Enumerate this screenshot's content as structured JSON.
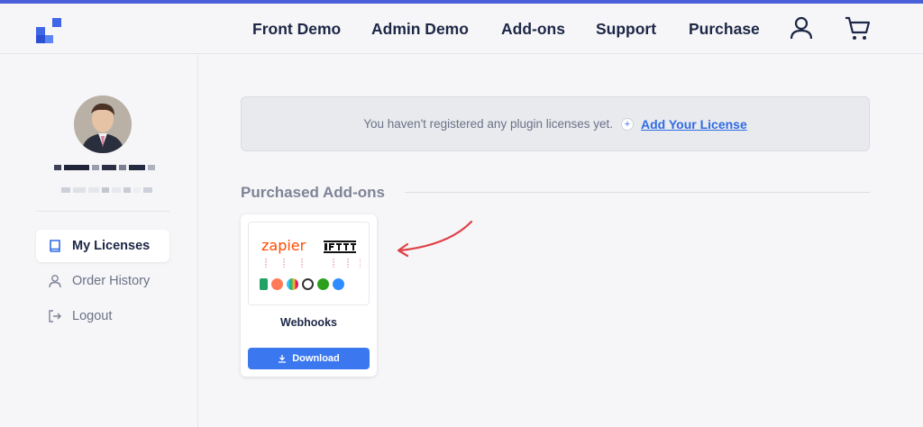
{
  "nav": {
    "items": [
      "Front Demo",
      "Admin Demo",
      "Add-ons",
      "Support",
      "Purchase"
    ],
    "user_icon": "user-icon",
    "cart_icon": "cart-icon"
  },
  "sidebar": {
    "items": [
      {
        "label": "My Licenses",
        "icon": "book-icon",
        "active": true
      },
      {
        "label": "Order History",
        "icon": "user-icon",
        "active": false
      },
      {
        "label": "Logout",
        "icon": "logout-icon",
        "active": false
      }
    ]
  },
  "notice": {
    "text": "You haven't registered any plugin licenses yet.",
    "link_label": "Add Your License"
  },
  "section": {
    "title": "Purchased Add-ons"
  },
  "addons": [
    {
      "title": "Webhooks",
      "button_label": "Download",
      "image_text": {
        "zapier": "zapier",
        "ifttt": "IFTTT"
      }
    }
  ],
  "colors": {
    "accent": "#3b78f0",
    "link": "#2f6be4",
    "top_bar": "#4a5fd9",
    "annotation_arrow": "#e0424a"
  }
}
